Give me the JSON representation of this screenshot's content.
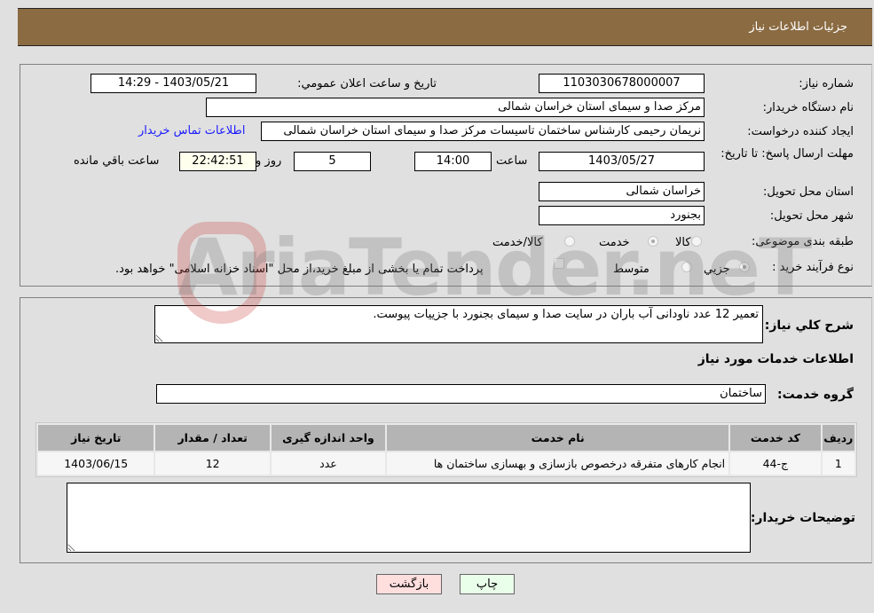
{
  "header": {
    "title": "جزئیات اطلاعات نیاز"
  },
  "form": {
    "need_number_label": "شماره نیاز:",
    "need_number": "1103030678000007",
    "announce_label": "تاریخ و ساعت اعلان عمومي:",
    "announce_value": "1403/05/21 - 14:29",
    "buyer_org_label": "نام دستگاه خریدار:",
    "buyer_org": "مرکز صدا و سیمای استان خراسان شمالی",
    "creator_label": "ایجاد کننده درخواست:",
    "creator": "نریمان رحیمی کارشناس ساختمان تاسیسات مرکز صدا و سیمای استان خراسان شمالی",
    "contact_link": "اطلاعات تماس خریدار",
    "deadline_label": "مهلت ارسال پاسخ: تا تاریخ:",
    "deadline_date": "1403/05/27",
    "time_label": "ساعت",
    "deadline_time": "14:00",
    "days_value": "5",
    "days_label": "روز و",
    "remaining_time": "22:42:51",
    "remaining_label": "ساعت باقي مانده",
    "province_label": "استان محل تحویل:",
    "province": "خراسان شمالی",
    "city_label": "شهر محل تحویل:",
    "city": "بجنورد",
    "category_label": "طبقه بندی موضوعی:",
    "category_options": [
      {
        "label": "کالا",
        "selected": false
      },
      {
        "label": "خدمت",
        "selected": true
      },
      {
        "label": "کالا/خدمت",
        "selected": false
      }
    ],
    "purchase_type_label": "نوع فرآیند خرید :",
    "purchase_options": [
      {
        "label": "جزيي",
        "selected": true
      },
      {
        "label": "متوسط",
        "selected": false
      }
    ],
    "payment_note": "پرداخت تمام یا بخشی از مبلغ خرید،از محل \"اسناد خزانه اسلامی\" خواهد بود."
  },
  "details": {
    "description_label": "شرح كلي نياز:",
    "description": "تعمیر 12 عدد ناودانی آب باران در سایت صدا و سیمای بجنورد با جزییات پیوست.",
    "services_heading": "اطلاعات خدمات مورد نياز",
    "service_group_label": "گروه خدمت:",
    "service_group": "ساختمان",
    "table": {
      "headers": [
        "ردیف",
        "کد خدمت",
        "نام خدمت",
        "واحد اندازه گیری",
        "تعداد / مقدار",
        "تاریخ نیاز"
      ],
      "rows": [
        [
          "1",
          "ج-44",
          "انجام کارهای متفرقه درخصوص بازسازی و بهسازی ساختمان ها",
          "عدد",
          "12",
          "1403/06/15"
        ]
      ]
    },
    "buyer_notes_label": "توضیحات خریدار:",
    "buyer_notes": ""
  },
  "buttons": {
    "print": "چاپ",
    "back": "بازگشت"
  },
  "watermark": "AriaTender.neT"
}
